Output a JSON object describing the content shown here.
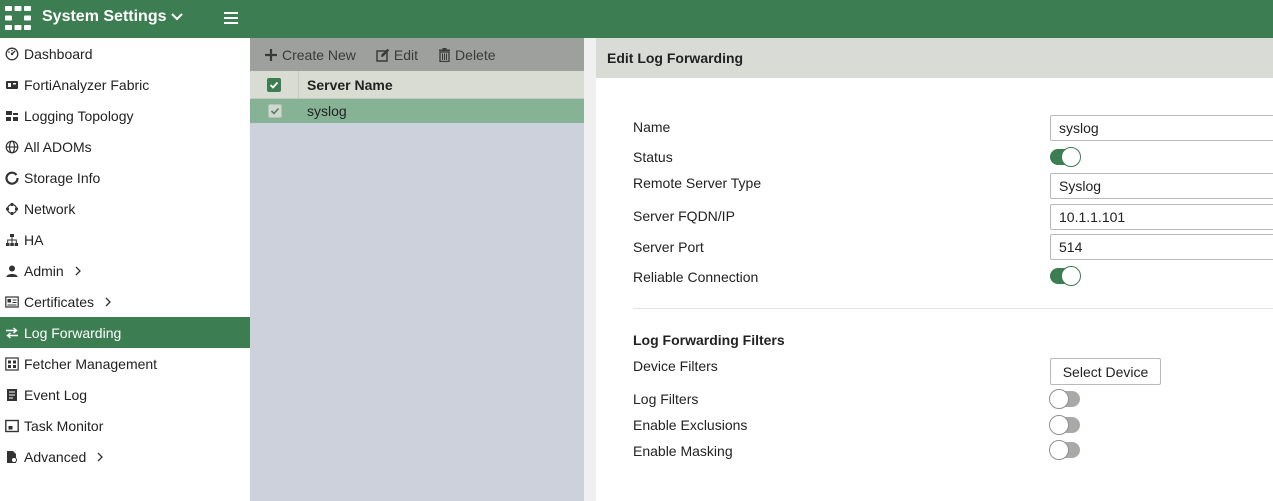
{
  "header": {
    "title": "System Settings",
    "title_icon": "chevron-down-icon",
    "menu_icon": "hamburger-icon",
    "brand_color": "#3c7d52"
  },
  "sidebar": {
    "items": [
      {
        "label": "Dashboard",
        "icon": "dashboard-icon"
      },
      {
        "label": "FortiAnalyzer Fabric",
        "icon": "fabric-icon"
      },
      {
        "label": "Logging Topology",
        "icon": "topology-icon"
      },
      {
        "label": "All ADOMs",
        "icon": "globe-icon"
      },
      {
        "label": "Storage Info",
        "icon": "storage-icon"
      },
      {
        "label": "Network",
        "icon": "network-icon"
      },
      {
        "label": "HA",
        "icon": "ha-icon"
      },
      {
        "label": "Admin",
        "icon": "user-icon",
        "expandable": true
      },
      {
        "label": "Certificates",
        "icon": "certificate-icon",
        "expandable": true
      },
      {
        "label": "Log Forwarding",
        "icon": "forwarding-icon",
        "active": true
      },
      {
        "label": "Fetcher Management",
        "icon": "fetcher-icon"
      },
      {
        "label": "Event Log",
        "icon": "event-log-icon"
      },
      {
        "label": "Task Monitor",
        "icon": "task-monitor-icon"
      },
      {
        "label": "Advanced",
        "icon": "advanced-icon",
        "expandable": true
      }
    ]
  },
  "list": {
    "toolbar": {
      "create_label": "Create New",
      "edit_label": "Edit",
      "delete_label": "Delete"
    },
    "column_header": "Server Name",
    "rows": [
      {
        "name": "syslog",
        "selected": true
      }
    ]
  },
  "edit": {
    "title": "Edit Log Forwarding",
    "name_label": "Name",
    "name_value": "syslog",
    "status_label": "Status",
    "status_on": true,
    "server_type_label": "Remote Server Type",
    "server_type_value": "Syslog",
    "fqdn_label": "Server FQDN/IP",
    "fqdn_value": "10.1.1.101",
    "port_label": "Server Port",
    "port_value": "514",
    "reliable_label": "Reliable Connection",
    "reliable_on": true,
    "filters_title": "Log Forwarding Filters",
    "device_filters_label": "Device Filters",
    "select_device_label": "Select Device",
    "log_filters_label": "Log Filters",
    "log_filters_on": false,
    "exclusions_label": "Enable Exclusions",
    "exclusions_on": false,
    "masking_label": "Enable Masking",
    "masking_on": false
  }
}
